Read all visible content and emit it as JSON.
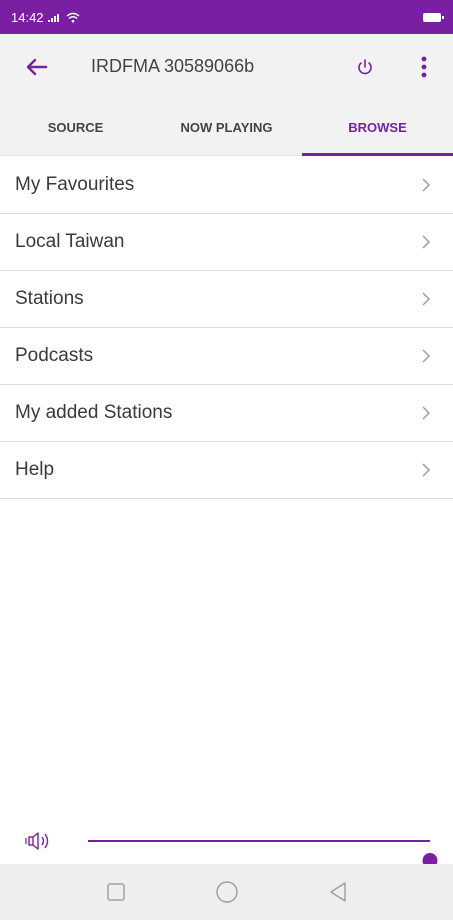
{
  "status_bar": {
    "time": "14:42",
    "signal_icon": "signal-icon",
    "wifi_icon": "wifi-icon",
    "battery_icon": "battery-icon"
  },
  "app_bar": {
    "back_icon": "arrow-left-icon",
    "device_name": "IRDFMA 30589066b",
    "power_icon": "power-icon",
    "menu_icon": "more-vert-icon"
  },
  "tabs": [
    {
      "label": "SOURCE",
      "active": false
    },
    {
      "label": "NOW PLAYING",
      "active": false
    },
    {
      "label": "BROWSE",
      "active": true
    }
  ],
  "browse_items": [
    {
      "label": "My Favourites"
    },
    {
      "label": "Local Taiwan"
    },
    {
      "label": "Stations"
    },
    {
      "label": "Podcasts"
    },
    {
      "label": "My added Stations"
    },
    {
      "label": "Help"
    }
  ],
  "volume": {
    "icon": "speaker-icon",
    "level": 1.0
  },
  "nav_bar": {
    "recents_icon": "square-icon",
    "home_icon": "circle-icon",
    "back_icon": "triangle-back-icon"
  },
  "colors": {
    "accent": "#7b1fa2",
    "app_bar_bg": "#f2f2f2",
    "nav_bar_bg": "#eeeeee"
  }
}
